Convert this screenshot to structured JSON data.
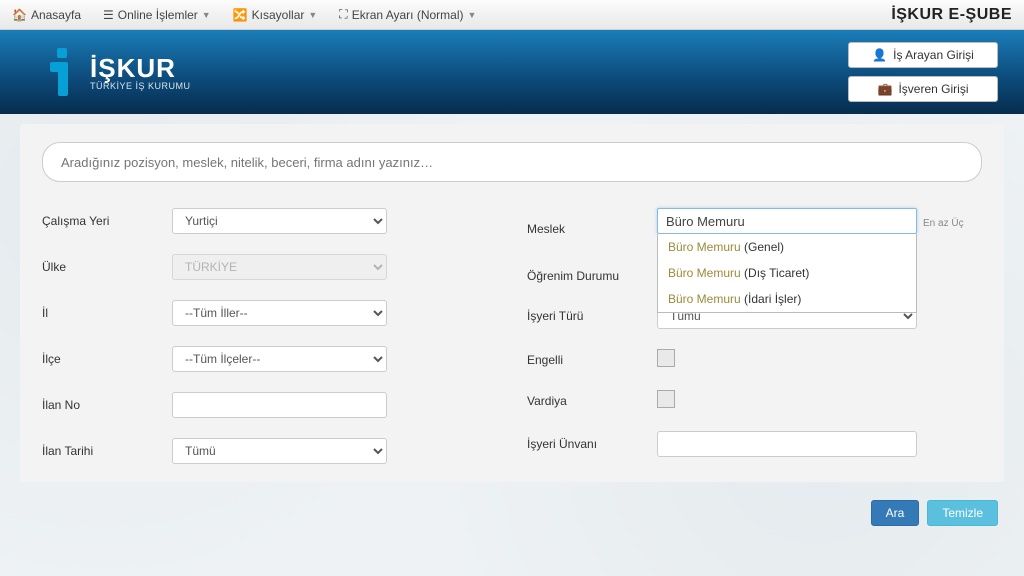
{
  "nav": {
    "home": "Anasayfa",
    "online": "Online İşlemler",
    "shortcuts": "Kısayollar",
    "screen": "Ekran Ayarı (Normal)",
    "brand": "İŞKUR E-ŞUBE"
  },
  "logo": {
    "name": "İŞKUR",
    "sub": "TÜRKİYE İŞ KURUMU"
  },
  "login": {
    "jobseeker": "İş Arayan Girişi",
    "employer": "İşveren Girişi"
  },
  "search": {
    "placeholder": "Aradığınız pozisyon, meslek, nitelik, beceri, firma adını yazınız…"
  },
  "left": {
    "workplace_label": "Çalışma Yeri",
    "workplace_value": "Yurtiçi",
    "country_label": "Ülke",
    "country_value": "TÜRKİYE",
    "province_label": "İl",
    "province_value": "--Tüm İller--",
    "district_label": "İlçe",
    "district_value": "--Tüm İlçeler--",
    "ad_no_label": "İlan No",
    "ad_date_label": "İlan Tarihi",
    "ad_date_value": "Tümü"
  },
  "right": {
    "occupation_label": "Meslek",
    "occupation_value": "Büro Memuru",
    "occupation_hint": "En az Üç Harf Giriniz.",
    "suggestions": [
      {
        "match": "Büro Memuru",
        "rest": " (Genel)"
      },
      {
        "match": "Büro Memuru",
        "rest": " (Dış Ticaret)"
      },
      {
        "match": "Büro Memuru",
        "rest": " (İdari İşler)"
      }
    ],
    "education_label": "Öğrenim Durumu",
    "worktype_label": "İşyeri Türü",
    "worktype_value": "Tümü",
    "disabled_label": "Engelli",
    "shift_label": "Vardiya",
    "title_label": "İşyeri Ünvanı"
  },
  "actions": {
    "search": "Ara",
    "clear": "Temizle"
  }
}
